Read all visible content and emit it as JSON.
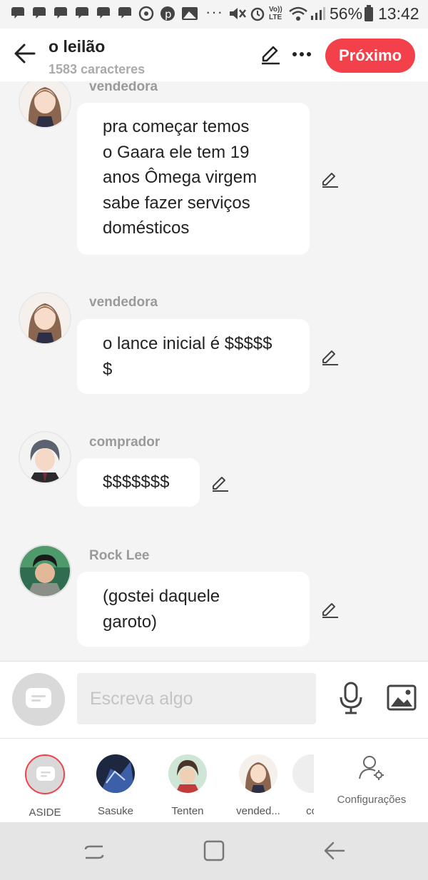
{
  "status_bar": {
    "battery": "56%",
    "time": "13:42",
    "volte": "Vo)) LTE"
  },
  "header": {
    "title": "o leilão",
    "subtitle": "1583 caracteres",
    "next_label": "Próximo"
  },
  "messages": [
    {
      "sender": "vendedora",
      "lines": [
        "pra começar temos",
        "o Gaara ele tem 19",
        "anos Ômega virgem",
        "sabe fazer serviços",
        "domésticos"
      ]
    },
    {
      "sender": "vendedora",
      "lines": [
        "o lance inicial é $$$$$",
        "$"
      ]
    },
    {
      "sender": "comprador",
      "lines": [
        "$$$$$$$"
      ]
    },
    {
      "sender": "Rock Lee",
      "lines": [
        "(gostei daquele",
        "garoto)"
      ]
    }
  ],
  "input": {
    "placeholder": "Escreva algo"
  },
  "characters": [
    {
      "label": "ASIDE"
    },
    {
      "label": "Sasuke"
    },
    {
      "label": "Tenten"
    },
    {
      "label": "vended..."
    },
    {
      "label": "co"
    }
  ],
  "settings_label": "Configurações",
  "colors": {
    "accent": "#f2414b",
    "bubble": "#ffffff",
    "background": "#f4f4f4"
  }
}
